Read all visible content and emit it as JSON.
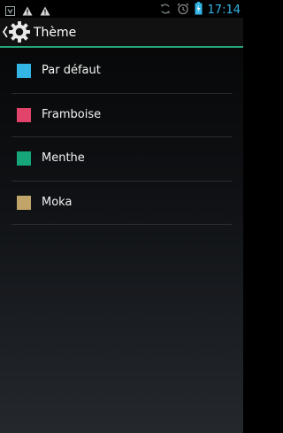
{
  "status_bar": {
    "time": "17:14",
    "icons": [
      "android-debug-icon",
      "warning-icon",
      "warning-icon",
      "sync-icon",
      "alarm-icon",
      "battery-charging-icon"
    ],
    "time_color": "#33b5e5"
  },
  "action_bar": {
    "title": "Thème",
    "icon": "gear-icon",
    "accent_color": "#28a67a"
  },
  "themes": [
    {
      "label": "Par défaut",
      "color": "#33b5e5"
    },
    {
      "label": "Framboise",
      "color": "#e2436b"
    },
    {
      "label": "Menthe",
      "color": "#17a67a"
    },
    {
      "label": "Moka",
      "color": "#c0a469"
    }
  ]
}
